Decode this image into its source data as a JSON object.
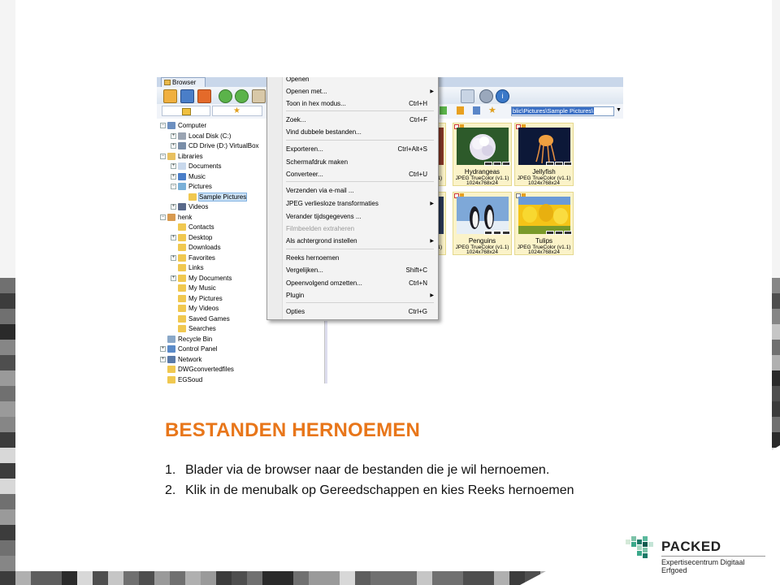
{
  "slide": {
    "title": "BESTANDEN HERNOEMEN",
    "steps": [
      {
        "num": "1.",
        "text": "Blader via de browser naar de bestanden die je wil hernoemen."
      },
      {
        "num": "2.",
        "text": "Klik in de menubalk op Gereedschappen en kies Reeks hernoemen"
      }
    ],
    "colors": {
      "title": "#e8761a",
      "tile_dark": "#5a5a5a",
      "tile_light": "#d8d8d8"
    }
  },
  "logo": {
    "name": "PACKED",
    "subtitle": "Expertisecentrum Digitaal Erfgoed"
  },
  "app": {
    "tab_label": "Browser",
    "address": "blic\\Pictures\\Sample Pictures\\",
    "tree": [
      {
        "label": "Computer",
        "icon": "computer-icon"
      },
      {
        "label": "Local Disk (C:)",
        "icon": "disk-icon"
      },
      {
        "label": "CD Drive (D:) VirtualBox",
        "icon": "cd-icon"
      },
      {
        "label": "Libraries",
        "icon": "libraries-icon"
      },
      {
        "label": "Documents",
        "icon": "documents-icon"
      },
      {
        "label": "Music",
        "icon": "music-icon"
      },
      {
        "label": "Pictures",
        "icon": "pictures-icon"
      },
      {
        "label": "Sample Pictures",
        "icon": "folder-icon"
      },
      {
        "label": "Videos",
        "icon": "videos-icon"
      },
      {
        "label": "henk",
        "icon": "user-icon"
      },
      {
        "label": "Contacts",
        "icon": "folder-icon"
      },
      {
        "label": "Desktop",
        "icon": "folder-icon"
      },
      {
        "label": "Downloads",
        "icon": "folder-icon"
      },
      {
        "label": "Favorites",
        "icon": "folder-icon"
      },
      {
        "label": "Links",
        "icon": "folder-icon"
      },
      {
        "label": "My Documents",
        "icon": "folder-icon"
      },
      {
        "label": "My Music",
        "icon": "folder-icon"
      },
      {
        "label": "My Pictures",
        "icon": "folder-icon"
      },
      {
        "label": "My Videos",
        "icon": "folder-icon"
      },
      {
        "label": "Saved Games",
        "icon": "folder-icon"
      },
      {
        "label": "Searches",
        "icon": "folder-icon"
      },
      {
        "label": "Recycle Bin",
        "icon": "recycle-bin-icon"
      },
      {
        "label": "Control Panel",
        "icon": "control-panel-icon"
      },
      {
        "label": "Network",
        "icon": "network-icon"
      },
      {
        "label": "DWGconvertedfiles",
        "icon": "folder-icon"
      },
      {
        "label": "EGSoud",
        "icon": "folder-icon"
      }
    ],
    "menu": [
      {
        "label": "Openen",
        "shortcut": ""
      },
      {
        "label": "Openen met...",
        "shortcut": "",
        "submenu": true
      },
      {
        "label": "Toon in hex modus...",
        "shortcut": "Ctrl+H"
      },
      {
        "label": "Zoek...",
        "shortcut": "Ctrl+F"
      },
      {
        "label": "Vind dubbele bestanden...",
        "shortcut": ""
      },
      {
        "label": "Exporteren...",
        "shortcut": "Ctrl+Alt+S"
      },
      {
        "label": "Schermafdruk maken",
        "shortcut": ""
      },
      {
        "label": "Converteer...",
        "shortcut": "Ctrl+U"
      },
      {
        "label": "Verzenden via e-mail ...",
        "shortcut": ""
      },
      {
        "label": "JPEG verliesloze transformaties",
        "shortcut": "",
        "submenu": true
      },
      {
        "label": "Verander tijdsgegevens ...",
        "shortcut": ""
      },
      {
        "label": "Filmbeelden extraheren",
        "shortcut": "",
        "disabled": true
      },
      {
        "label": "Als achtergrond instellen",
        "shortcut": "",
        "submenu": true
      },
      {
        "label": "Reeks hernoemen",
        "shortcut": ""
      },
      {
        "label": "Vergelijken...",
        "shortcut": "Shift+C"
      },
      {
        "label": "Opeenvolgend omzetten...",
        "shortcut": "Ctrl+N"
      },
      {
        "label": "Plugin",
        "shortcut": "",
        "submenu": true
      },
      {
        "label": "Opties",
        "shortcut": "Ctrl+G"
      }
    ],
    "thumbs": [
      {
        "name": "Hydrangeas",
        "format": "JPEG TrueColor (v1.1)",
        "size": "1024x768x24"
      },
      {
        "name": "Jellyfish",
        "format": "JPEG TrueColor (v1.1)",
        "size": "1024x768x24"
      },
      {
        "name": "Penguins",
        "format": "JPEG TrueColor (v1.1)",
        "size": "1024x768x24"
      },
      {
        "name": "Tulips",
        "format": "JPEG TrueColor (v1.1)",
        "size": "1024x768x24"
      }
    ],
    "partial_labels": [
      "v1.1)",
      "v1.1)",
      "e"
    ]
  }
}
